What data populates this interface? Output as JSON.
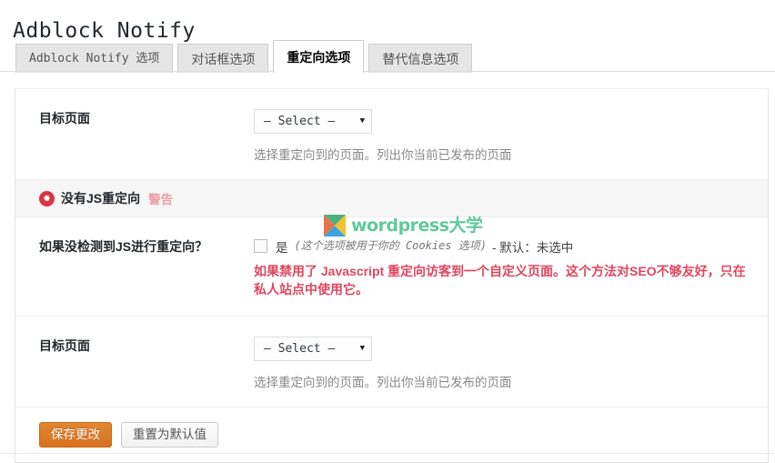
{
  "page": {
    "title": "Adblock Notify"
  },
  "tabs": [
    {
      "label": "Adblock Notify 选项",
      "active": false,
      "mono": true
    },
    {
      "label": "对话框选项",
      "active": false,
      "mono": false
    },
    {
      "label": "重定向选项",
      "active": true,
      "mono": false
    },
    {
      "label": "替代信息选项",
      "active": false,
      "mono": false
    }
  ],
  "rows": {
    "target_page_top": {
      "label": "目标页面",
      "select_value": "— Select —",
      "caret": "▼",
      "hint": "选择重定向到的页面。列出你当前已发布的页面"
    },
    "warning": {
      "icon": "warning-star-icon",
      "title": "没有JS重定向",
      "tag": "警告",
      "icon_color": "#d9353f",
      "tag_color": "#eaa1a5"
    },
    "nojs_redirect": {
      "label": "如果没检测到JS进行重定向？",
      "checkbox_checked": false,
      "checkbox_text": "是",
      "checkbox_note": "(这个选项被用于你的 Cookies 选项)",
      "checkbox_default": "- 默认：未选中",
      "description": "如果禁用了 Javascript 重定向访客到一个自定义页面。这个方法对SEO不够友好，只在私人站点中使用它。",
      "description_color": "#e0465c"
    },
    "target_page_bottom": {
      "label": "目标页面",
      "select_value": "— Select —",
      "caret": "▼",
      "hint": "选择重定向到的页面。列出你当前已发布的页面"
    }
  },
  "footer": {
    "save_label": "保存更改",
    "reset_label": "重置为默认值",
    "save_color": "#dd7a29"
  },
  "watermark": {
    "text": "wordpress大学",
    "mark": "x-diamond-logo",
    "colors": {
      "top": "#4caf7d",
      "left": "#e8734a",
      "bottom": "#3aa3e0",
      "right": "#f2c230"
    }
  }
}
